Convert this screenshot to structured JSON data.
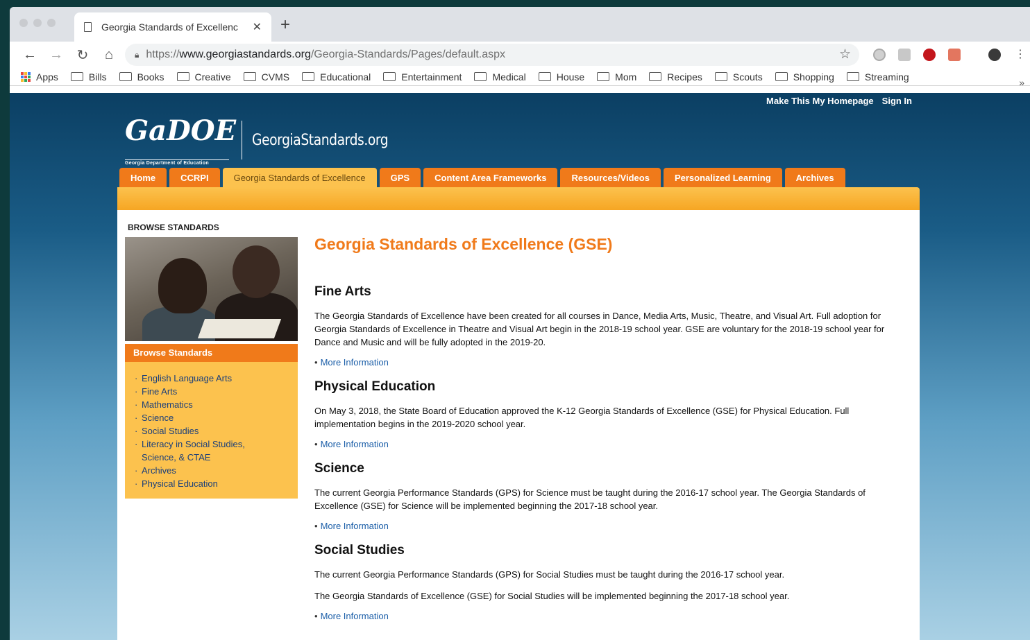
{
  "browser": {
    "tab_title": "Georgia Standards of Excellenc",
    "url_scheme": "https://",
    "url_host": "www.georgiastandards.org",
    "url_path": "/Georgia-Standards/Pages/default.aspx",
    "bookmarks": [
      "Bills",
      "Books",
      "Creative",
      "CVMS",
      "Educational",
      "Entertainment",
      "Medical",
      "House",
      "Mom",
      "Recipes",
      "Scouts",
      "Shopping",
      "Streaming"
    ],
    "apps_label": "Apps",
    "more_bookmarks": "»"
  },
  "header": {
    "make_homepage": "Make This My Homepage",
    "sign_in": "Sign In",
    "logo_text": "GaDOE",
    "logo_subtext": "Georgia Department of Education",
    "site_name": "GeorgiaStandards.org"
  },
  "nav": {
    "tabs": [
      "Home",
      "CCRPI",
      "Georgia Standards of Excellence",
      "GPS",
      "Content Area Frameworks",
      "Resources/Videos",
      "Personalized Learning",
      "Archives"
    ],
    "active_index": 2
  },
  "sidebar": {
    "heading": "BROWSE STANDARDS",
    "browse_title": "Browse Standards",
    "items": [
      "English Language Arts",
      "Fine Arts",
      "Mathematics",
      "Science",
      "Social Studies",
      "Literacy in Social Studies,",
      "Science, & CTAE",
      "Archives",
      "Physical Education"
    ]
  },
  "main": {
    "title": "Georgia Standards of Excellence (GSE)",
    "more_label": "More Information",
    "sections": [
      {
        "heading": "Fine Arts",
        "paragraphs": [
          "The Georgia Standards of Excellence have been created for all courses in Dance, Media Arts, Music, Theatre, and Visual Art. Full adoption for Georgia Standards of Excellence in Theatre and Visual Art begin in the 2018-19 school year. GSE are voluntary for the 2018-19 school year for Dance and Music and will be fully adopted in the 2019-20."
        ]
      },
      {
        "heading": "Physical Education",
        "paragraphs": [
          "On May 3, 2018, the State Board of Education approved the K-12 Georgia Standards of Excellence (GSE) for Physical Education. Full implementation begins in the 2019-2020 school year."
        ]
      },
      {
        "heading": "Science",
        "paragraphs": [
          "The current Georgia Performance Standards (GPS) for Science must be taught during the 2016-17 school year. The Georgia Standards of Excellence (GSE) for Science will be implemented beginning the 2017-18 school year."
        ]
      },
      {
        "heading": "Social Studies",
        "paragraphs": [
          "The current Georgia Performance Standards (GPS) for Social Studies must be taught during the 2016-17 school year.",
          "The Georgia Standards of Excellence (GSE) for Social Studies will be implemented beginning the 2017-18 school year."
        ]
      }
    ]
  },
  "colors": {
    "orange": "#f07a1a",
    "gold": "#fcc24e",
    "link": "#1b5ea8"
  }
}
